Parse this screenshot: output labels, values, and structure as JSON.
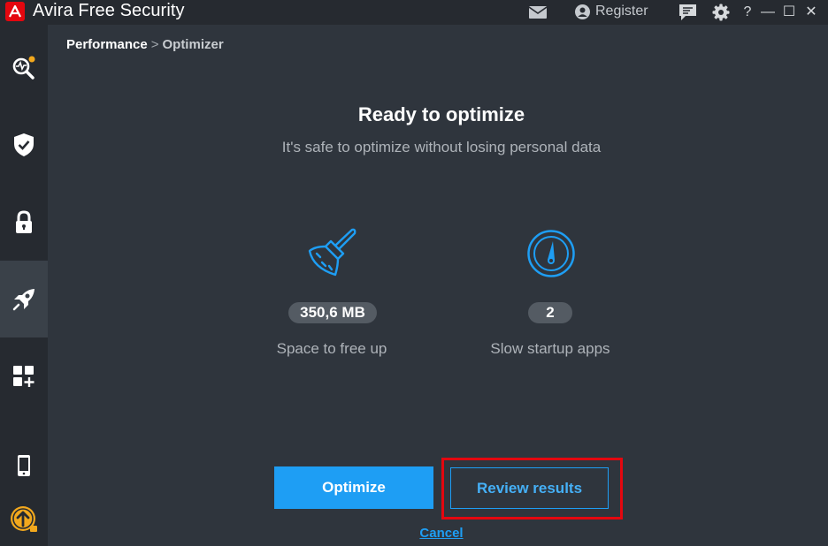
{
  "window": {
    "app_name": "Avira",
    "app_suffix": "Free Security",
    "register_label": "Register",
    "help_label": "?",
    "minimize_label": "—",
    "maximize_label": "☐",
    "close_label": "✕"
  },
  "breadcrumb": {
    "root": "Performance",
    "separator": ">",
    "current": "Optimizer"
  },
  "main": {
    "title": "Ready to optimize",
    "subtitle": "It's safe to optimize without losing personal data"
  },
  "stats": [
    {
      "icon": "broom-icon",
      "value": "350,6 MB",
      "label": "Space to free up"
    },
    {
      "icon": "speedometer-icon",
      "value": "2",
      "label": "Slow startup apps"
    }
  ],
  "actions": {
    "optimize_label": "Optimize",
    "review_label": "Review results",
    "cancel_label": "Cancel"
  },
  "sidebar": {
    "items": [
      {
        "name": "status-scan",
        "icon": "magnifier-pulse-icon"
      },
      {
        "name": "security",
        "icon": "shield-check-icon"
      },
      {
        "name": "privacy",
        "icon": "padlock-icon"
      },
      {
        "name": "performance",
        "icon": "rocket-icon",
        "active": true
      },
      {
        "name": "more-apps",
        "icon": "apps-plus-icon"
      },
      {
        "name": "mobile",
        "icon": "smartphone-icon"
      },
      {
        "name": "upgrade",
        "icon": "upgrade-arrow-icon"
      }
    ]
  },
  "colors": {
    "accent": "#1e9ef4",
    "brand_red": "#e4070f",
    "background": "#2f353d",
    "sidebar": "#262a30",
    "upgrade_orange": "#f2a81d"
  }
}
